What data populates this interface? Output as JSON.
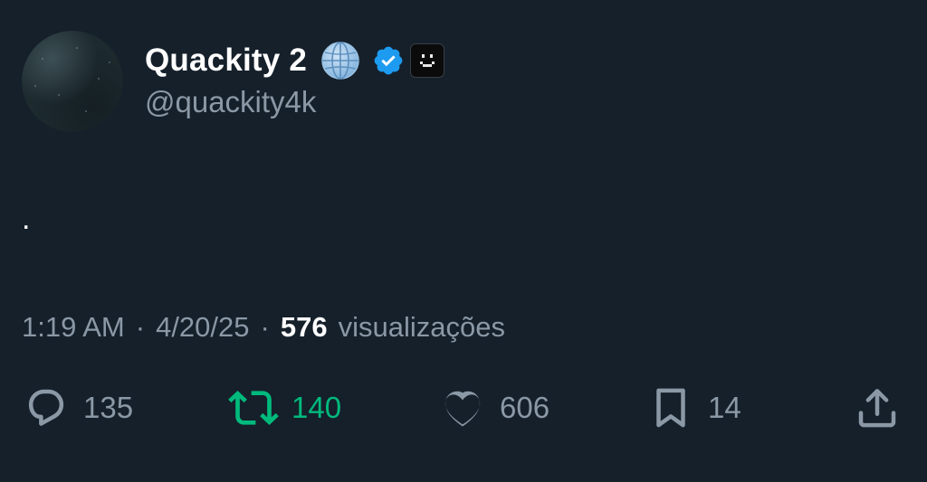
{
  "tweet": {
    "author": {
      "display_name": "Quackity 2",
      "handle": "@quackity4k",
      "verified": true,
      "avatar_icon": "avatar-image"
    },
    "text": ".",
    "meta": {
      "time": "1:19 AM",
      "separator": "·",
      "date": "4/20/25",
      "views_count": "576",
      "views_label": "visualizações"
    },
    "actions": {
      "reply": {
        "icon": "reply-icon",
        "count": "135"
      },
      "retweet": {
        "icon": "retweet-icon",
        "count": "140"
      },
      "like": {
        "icon": "heart-icon",
        "count": "606"
      },
      "bookmark": {
        "icon": "bookmark-icon",
        "count": "14"
      },
      "share": {
        "icon": "share-icon"
      }
    }
  },
  "colors": {
    "background": "#15202b",
    "primary_text": "#ffffff",
    "secondary_text": "#8b98a5",
    "verified_blue": "#1d9bf0",
    "retweet_green": "#00ba7c"
  }
}
